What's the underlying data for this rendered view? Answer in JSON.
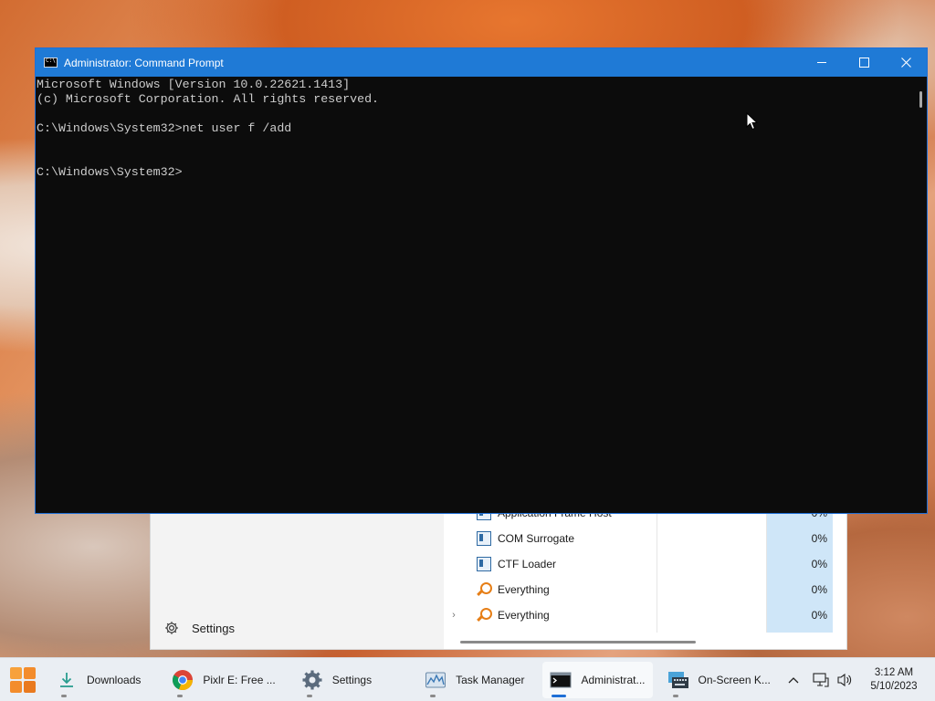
{
  "cmd": {
    "title": "Administrator: Command Prompt",
    "lines": [
      "Microsoft Windows [Version 10.0.22621.1413]",
      "(c) Microsoft Corporation. All rights reserved.",
      "",
      "C:\\Windows\\System32>net user f /add",
      "",
      "",
      "C:\\Windows\\System32>"
    ]
  },
  "task_manager": {
    "settings_label": "Settings",
    "rows": [
      {
        "name": "Application Frame Host",
        "cpu": "0%",
        "icon": "window-icon",
        "expandable": false
      },
      {
        "name": "COM Surrogate",
        "cpu": "0%",
        "icon": "window-icon",
        "expandable": false
      },
      {
        "name": "CTF Loader",
        "cpu": "0%",
        "icon": "window-icon",
        "expandable": false
      },
      {
        "name": "Everything",
        "cpu": "0%",
        "icon": "magnifier-icon",
        "expandable": false
      },
      {
        "name": "Everything",
        "cpu": "0%",
        "icon": "magnifier-icon",
        "expandable": true
      }
    ]
  },
  "taskbar": {
    "items": [
      {
        "label": "Downloads",
        "icon": "download-icon",
        "active": false
      },
      {
        "label": "Pixlr E: Free ...",
        "icon": "chrome-icon",
        "active": false
      },
      {
        "label": "Settings",
        "icon": "gear-icon",
        "active": false
      },
      {
        "label": "Task Manager",
        "icon": "task-manager-icon",
        "active": false
      },
      {
        "label": "Administrat...",
        "icon": "cmd-icon",
        "active": true
      },
      {
        "label": "On-Screen K...",
        "icon": "keyboard-icon",
        "active": false
      }
    ],
    "clock_time": "3:12 AM",
    "clock_date": "5/10/2023"
  },
  "colors": {
    "titlebar": "#1f7ad6",
    "console_bg": "#0c0c0c",
    "console_fg": "#cccccc",
    "taskbar_bg": "#eaeef3"
  }
}
